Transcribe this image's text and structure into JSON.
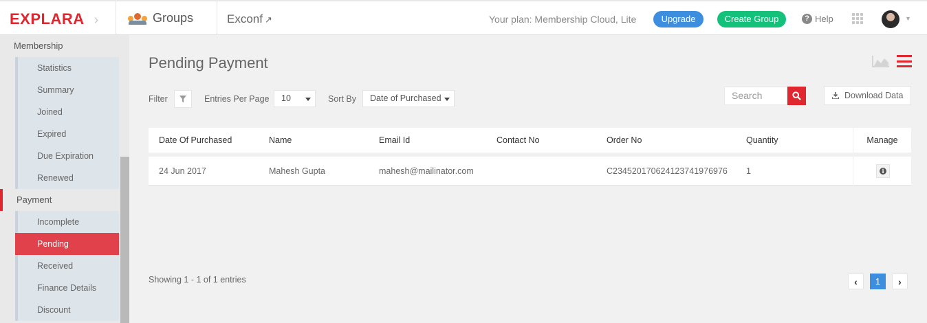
{
  "header": {
    "logo": "EXPLARA",
    "logo_chevron": "›",
    "section_title": "Groups",
    "event_name": "Exconf",
    "plan_text": "Your plan: Membership Cloud, Lite",
    "upgrade_label": "Upgrade",
    "create_group_label": "Create Group",
    "help_label": "Help",
    "help_icon": "?"
  },
  "sidebar": {
    "membership_label": "Membership",
    "membership_items": [
      "Statistics",
      "Summary",
      "Joined",
      "Expired",
      "Due Expiration",
      "Renewed"
    ],
    "payment_label": "Payment",
    "payment_items": [
      "Incomplete",
      "Pending",
      "Received",
      "Finance Details",
      "Discount"
    ],
    "active_item": "Pending"
  },
  "main": {
    "title": "Pending Payment",
    "filter_label": "Filter",
    "entries_label": "Entries Per Page",
    "entries_value": "10",
    "sort_label": "Sort By",
    "sort_value": "Date of Purchased",
    "search_placeholder": "Search",
    "download_label": "Download Data"
  },
  "table": {
    "columns": [
      "Date Of Purchased",
      "Name",
      "Email Id",
      "Contact No",
      "Order No",
      "Quantity",
      "Manage"
    ],
    "rows": [
      {
        "date": "24 Jun 2017",
        "name": "Mahesh Gupta",
        "email": "mahesh@mailinator.com",
        "contact": "",
        "order_no": "C23452017062412374197697​6",
        "quantity": "1"
      }
    ]
  },
  "footer": {
    "showing": "Showing 1 - 1 of 1 entries",
    "current_page": "1",
    "prev": "‹",
    "next": "›"
  },
  "colors": {
    "brand_red": "#e0262f",
    "upgrade_blue": "#3e8ee0",
    "create_green": "#14c17a"
  }
}
